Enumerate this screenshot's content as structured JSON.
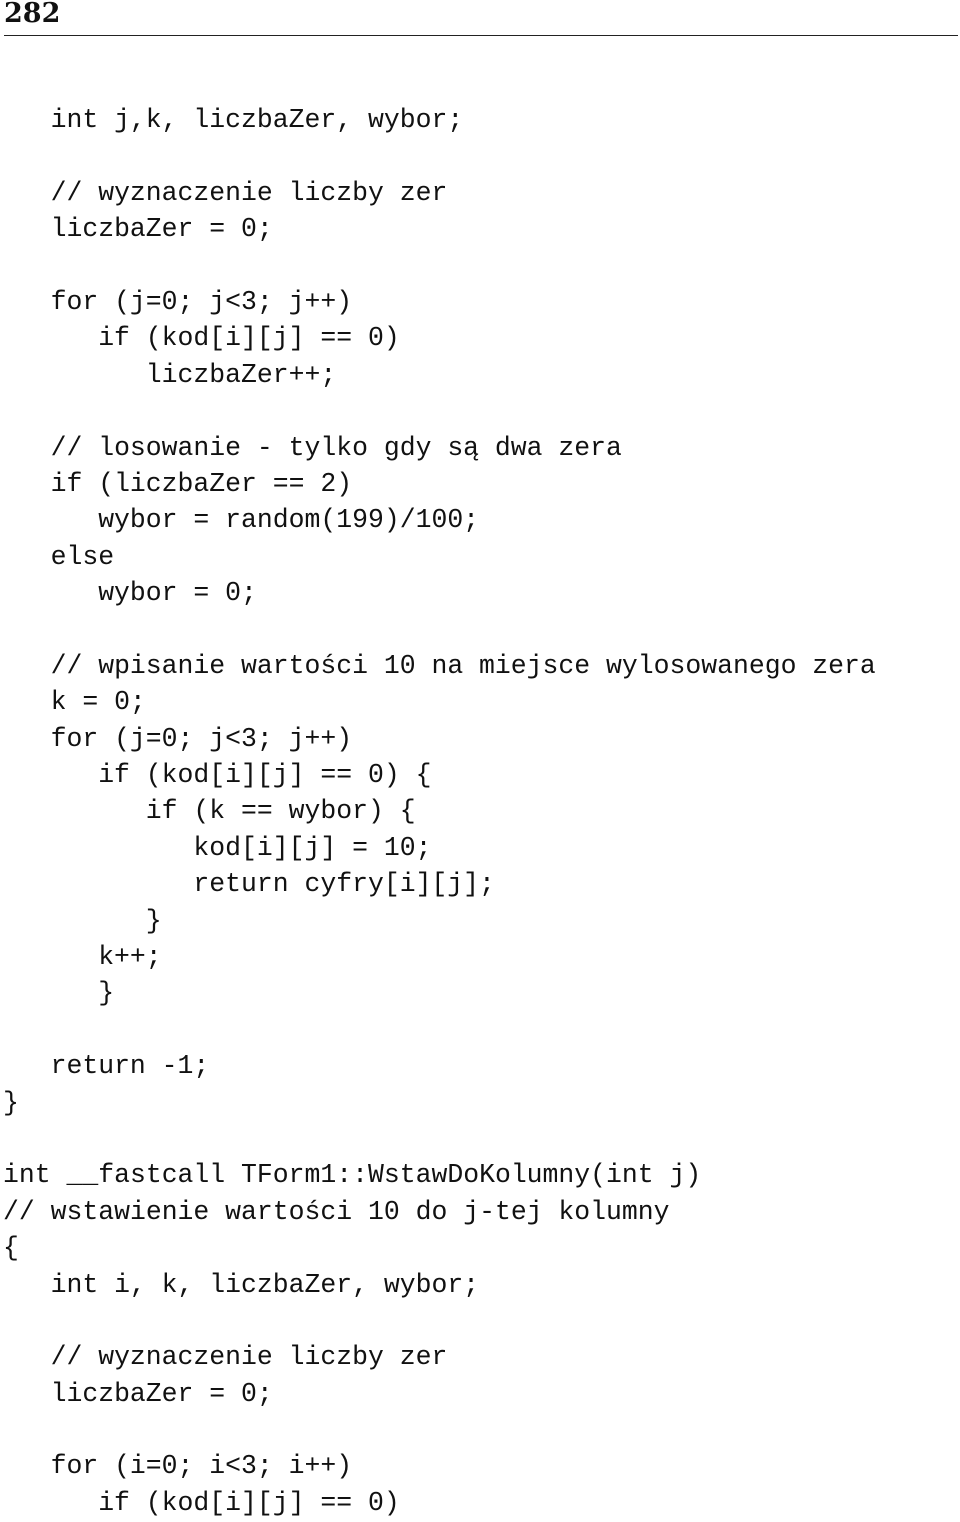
{
  "page": {
    "number": "282"
  },
  "code": {
    "language": "C++",
    "lines": [
      {
        "indent": 1,
        "text": "int j,k, liczbaZer, wybor;"
      },
      {
        "indent": 0,
        "text": ""
      },
      {
        "indent": 1,
        "text": "// wyznaczenie liczby zer"
      },
      {
        "indent": 1,
        "text": "liczbaZer = 0;"
      },
      {
        "indent": 0,
        "text": ""
      },
      {
        "indent": 1,
        "text": "for (j=0; j<3; j++)"
      },
      {
        "indent": 2,
        "text": "if (kod[i][j] == 0)"
      },
      {
        "indent": 3,
        "text": "liczbaZer++;"
      },
      {
        "indent": 0,
        "text": ""
      },
      {
        "indent": 1,
        "text": "// losowanie - tylko gdy są dwa zera"
      },
      {
        "indent": 1,
        "text": "if (liczbaZer == 2)"
      },
      {
        "indent": 2,
        "text": "wybor = random(199)/100;"
      },
      {
        "indent": 1,
        "text": "else"
      },
      {
        "indent": 2,
        "text": "wybor = 0;"
      },
      {
        "indent": 0,
        "text": ""
      },
      {
        "indent": 1,
        "text": "// wpisanie wartości 10 na miejsce wylosowanego zera"
      },
      {
        "indent": 1,
        "text": "k = 0;"
      },
      {
        "indent": 1,
        "text": "for (j=0; j<3; j++)"
      },
      {
        "indent": 2,
        "text": "if (kod[i][j] == 0) {"
      },
      {
        "indent": 3,
        "text": "if (k == wybor) {"
      },
      {
        "indent": 4,
        "text": "kod[i][j] = 10;"
      },
      {
        "indent": 4,
        "text": "return cyfry[i][j];"
      },
      {
        "indent": 3,
        "text": "}"
      },
      {
        "indent": 2,
        "text": "k++;"
      },
      {
        "indent": 2,
        "text": "}"
      },
      {
        "indent": 0,
        "text": ""
      },
      {
        "indent": 1,
        "text": "return -1;"
      },
      {
        "indent": 0,
        "text": "}"
      },
      {
        "indent": 0,
        "text": ""
      },
      {
        "indent": 0,
        "text": "int __fastcall TForm1::WstawDoKolumny(int j)"
      },
      {
        "indent": 0,
        "text": "// wstawienie wartości 10 do j-tej kolumny"
      },
      {
        "indent": 0,
        "text": "{"
      },
      {
        "indent": 1,
        "text": "int i, k, liczbaZer, wybor;"
      },
      {
        "indent": 0,
        "text": ""
      },
      {
        "indent": 1,
        "text": "// wyznaczenie liczby zer"
      },
      {
        "indent": 1,
        "text": "liczbaZer = 0;"
      },
      {
        "indent": 0,
        "text": ""
      },
      {
        "indent": 1,
        "text": "for (i=0; i<3; i++)"
      },
      {
        "indent": 2,
        "text": "if (kod[i][j] == 0)"
      }
    ]
  }
}
